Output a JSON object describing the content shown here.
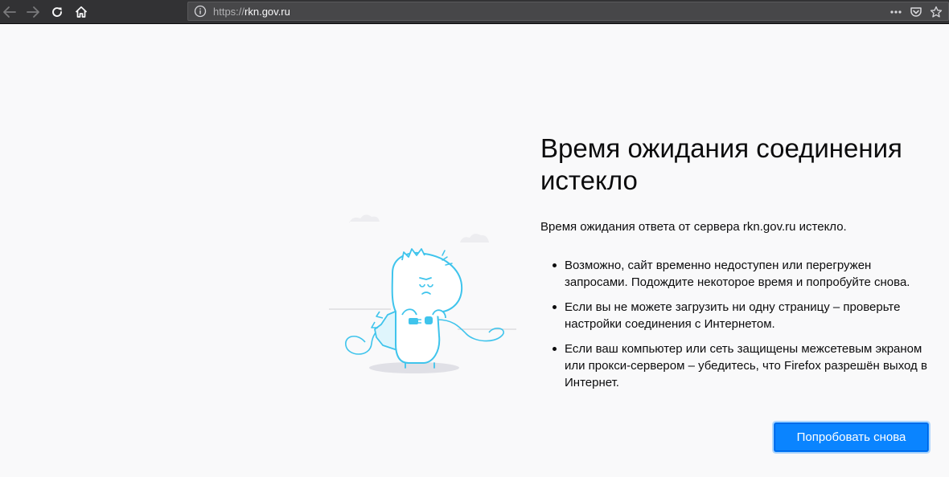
{
  "browser": {
    "url_scheme": "https://",
    "url_host": "rkn.gov.ru",
    "icons": {
      "back": "arrow-left-icon",
      "forward": "arrow-right-icon",
      "reload": "reload-icon",
      "home": "home-icon",
      "info": "info-icon",
      "page_actions": "more-horizontal-icon",
      "pocket": "pocket-icon",
      "bookmark": "star-icon"
    }
  },
  "error": {
    "title": "Время ожидания соединения истекло",
    "description": "Время ожидания ответа от сервера rkn.gov.ru истекло.",
    "suggestions": [
      "Возможно, сайт временно недоступен или перегружен запросами. Подождите некоторое время и попробуйте снова.",
      "Если вы не можете загрузить ни одну страницу – проверьте настройки соединения с Интернетом.",
      "Если ваш компьютер или сеть защищены межсетевым экраном или прокси-сервером – убедитесь, что Firefox разрешён выход в Интернет."
    ],
    "try_again_label": "Попробовать снова"
  },
  "colors": {
    "toolbar": "#323234",
    "page_background": "#f9f9fa",
    "accent": "#0a84ff",
    "illustration": "#3fc4ec"
  }
}
